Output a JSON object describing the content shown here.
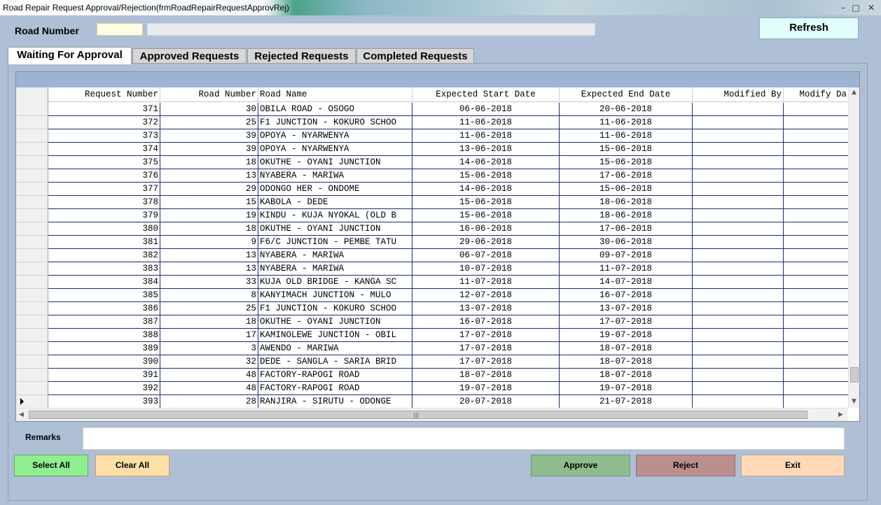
{
  "window": {
    "title": "Road Repair Request Approval/Rejection(frmRoadRepairRequestApprovRej)"
  },
  "form": {
    "road_number_label": "Road Number",
    "road_number_value": "",
    "road_name_value": "",
    "refresh_label": "Refresh"
  },
  "tabs": [
    {
      "label": "Waiting For Approval",
      "active": true
    },
    {
      "label": "Approved Requests",
      "active": false
    },
    {
      "label": "Rejected Requests",
      "active": false
    },
    {
      "label": "Completed Requests",
      "active": false
    }
  ],
  "grid": {
    "columns": [
      "Request Number",
      "Road Number",
      "Road Name",
      "Expected Start Date",
      "Expected End Date",
      "Modified By",
      "Modify Da"
    ],
    "rows": [
      [
        "371",
        "30",
        "OBILA ROAD - OSOGO",
        "06-06-2018",
        "20-06-2018",
        "",
        ""
      ],
      [
        "372",
        "25",
        "F1 JUNCTION - KOKURO SCHOO",
        "11-06-2018",
        "11-06-2018",
        "",
        ""
      ],
      [
        "373",
        "39",
        "OPOYA - NYARWENYA",
        "11-06-2018",
        "11-06-2018",
        "",
        ""
      ],
      [
        "374",
        "39",
        "OPOYA - NYARWENYA",
        "13-06-2018",
        "15-06-2018",
        "",
        ""
      ],
      [
        "375",
        "18",
        "OKUTHE - OYANI JUNCTION",
        "14-06-2018",
        "15-06-2018",
        "",
        ""
      ],
      [
        "376",
        "13",
        "NYABERA - MARIWA",
        "15-06-2018",
        "17-06-2018",
        "",
        ""
      ],
      [
        "377",
        "29",
        "ODONGO HER - ONDOME",
        "14-06-2018",
        "15-06-2018",
        "",
        ""
      ],
      [
        "378",
        "15",
        "KABOLA - DEDE",
        "15-06-2018",
        "18-06-2018",
        "",
        ""
      ],
      [
        "379",
        "19",
        "KINDU - KUJA NYOKAL (OLD B",
        "15-06-2018",
        "18-06-2018",
        "",
        ""
      ],
      [
        "380",
        "18",
        "OKUTHE - OYANI JUNCTION",
        "16-06-2018",
        "17-06-2018",
        "",
        ""
      ],
      [
        "381",
        "9",
        "F6/C JUNCTION - PEMBE TATU",
        "29-06-2018",
        "30-06-2018",
        "",
        ""
      ],
      [
        "382",
        "13",
        "NYABERA - MARIWA",
        "06-07-2018",
        "09-07-2018",
        "",
        ""
      ],
      [
        "383",
        "13",
        "NYABERA - MARIWA",
        "10-07-2018",
        "11-07-2018",
        "",
        ""
      ],
      [
        "384",
        "33",
        "KUJA OLD BRIDGE - KANGA SC",
        "11-07-2018",
        "14-07-2018",
        "",
        ""
      ],
      [
        "385",
        "8",
        "KANYIMACH JUNCTION - MULO",
        "12-07-2018",
        "16-07-2018",
        "",
        ""
      ],
      [
        "386",
        "25",
        "F1 JUNCTION - KOKURO SCHOO",
        "13-07-2018",
        "13-07-2018",
        "",
        ""
      ],
      [
        "387",
        "18",
        "OKUTHE - OYANI JUNCTION",
        "16-07-2018",
        "17-07-2018",
        "",
        ""
      ],
      [
        "388",
        "17",
        "KAMINOLEWE JUNCTION - OBIL",
        "17-07-2018",
        "19-07-2018",
        "",
        ""
      ],
      [
        "389",
        "3",
        "AWENDO - MARIWA",
        "17-07-2018",
        "18-07-2018",
        "",
        ""
      ],
      [
        "390",
        "32",
        "DEDE - SANGLA - SARIA BRID",
        "17-07-2018",
        "18-07-2018",
        "",
        ""
      ],
      [
        "391",
        "48",
        "FACTORY-RAPOGI ROAD",
        "18-07-2018",
        "18-07-2018",
        "",
        ""
      ],
      [
        "392",
        "48",
        "FACTORY-RAPOGI ROAD",
        "19-07-2018",
        "19-07-2018",
        "",
        ""
      ],
      [
        "393",
        "28",
        "RANJIRA - SIRUTU - ODONGE",
        "20-07-2018",
        "21-07-2018",
        "",
        ""
      ]
    ],
    "current_row_index": 22
  },
  "remarks": {
    "label": "Remarks",
    "value": ""
  },
  "buttons": {
    "select_all": "Select All",
    "clear_all": "Clear All",
    "approve": "Approve",
    "reject": "Reject",
    "exit": "Exit"
  },
  "colors": {
    "form_background": "#aebfd6",
    "grid_line": "#1c2a78",
    "select_all": "#90ee90",
    "clear_all": "#ffdfa8",
    "approve": "#8fbc8f",
    "reject": "#bc8f8f",
    "exit": "#ffdab9",
    "refresh": "#e2fbfb"
  }
}
